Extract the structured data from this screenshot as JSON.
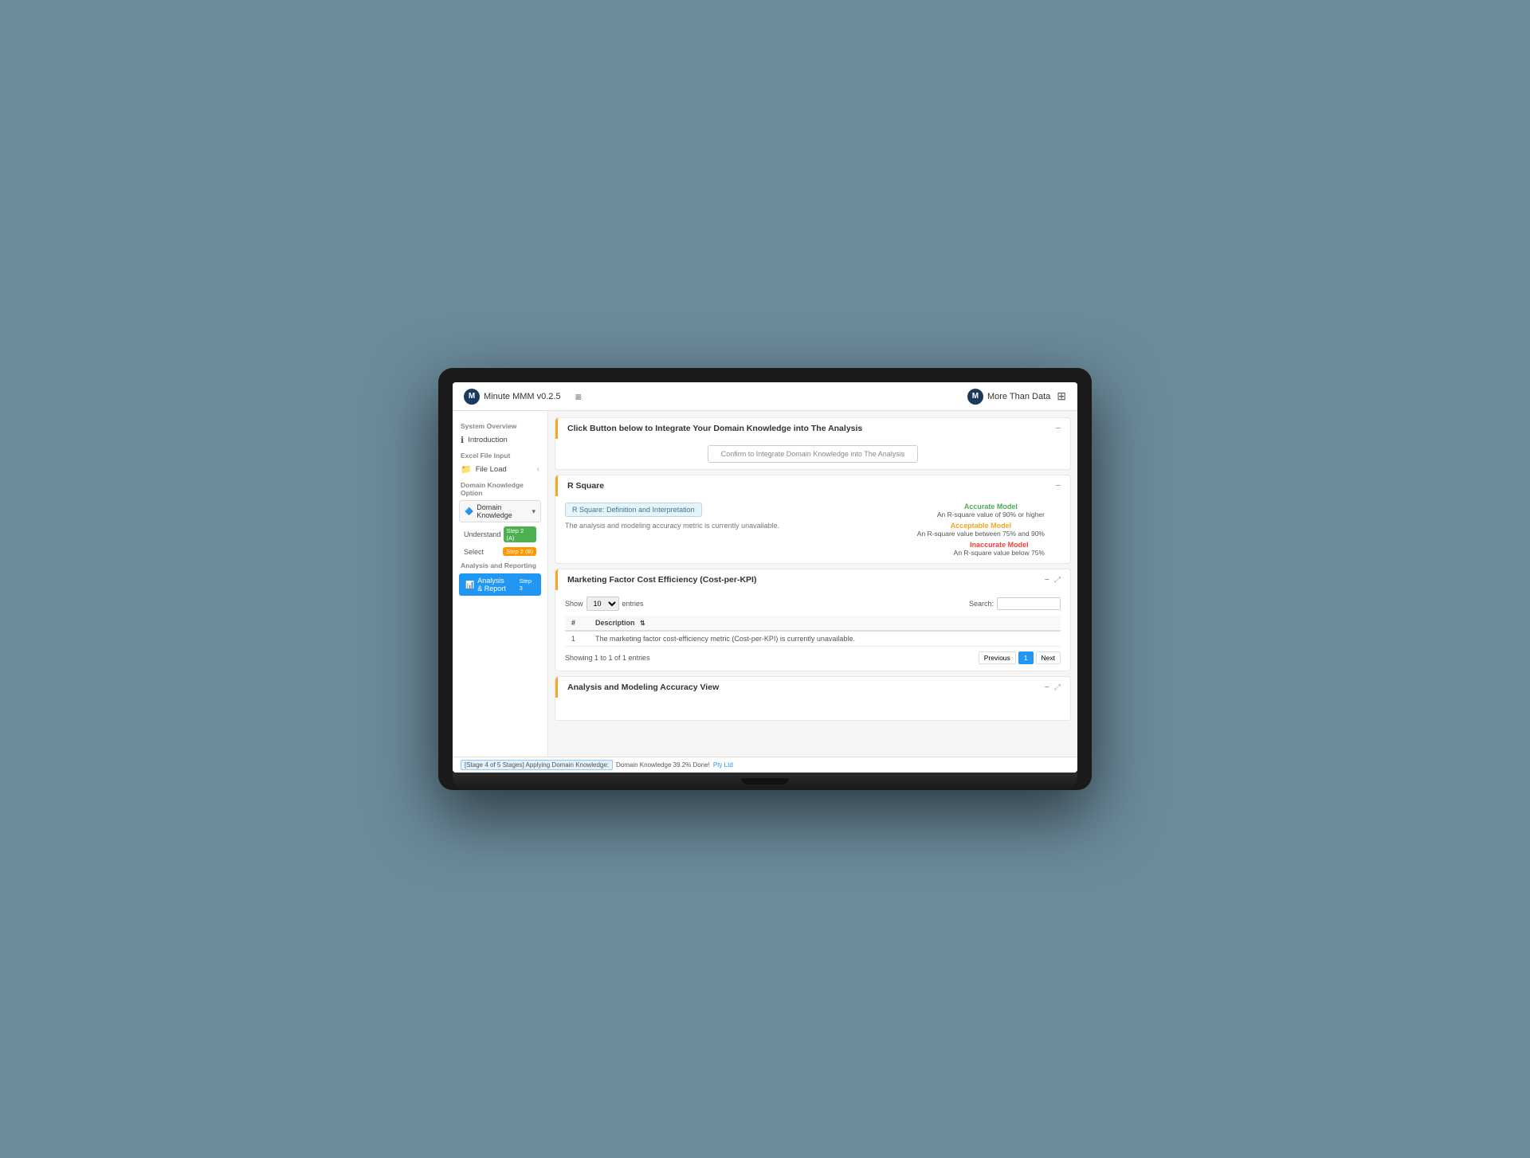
{
  "app": {
    "title": "Minute MMM v0.2.5",
    "brand": "More Than Data",
    "logo_letter": "M"
  },
  "navbar": {
    "hamburger": "≡",
    "grid_icon": "⊞"
  },
  "sidebar": {
    "system_overview_label": "System Overview",
    "introduction_label": "Introduction",
    "excel_file_input_label": "Excel File Input",
    "file_load_label": "File Load",
    "domain_knowledge_option_label": "Domain Knowledge Option",
    "domain_knowledge_dropdown": "Domain Knowledge",
    "understand_label": "Understand",
    "understand_badge": "Step 2 (A)",
    "select_label": "Select",
    "select_badge": "Step 2 (B)",
    "analysis_reporting_label": "Analysis and Reporting",
    "analysis_report_label": "Analysis & Report",
    "analysis_report_badge": "Step 3"
  },
  "domain_knowledge_card": {
    "title": "Click Button below to Integrate Your Domain Knowledge into The Analysis",
    "confirm_button": "Confirm to Integrate Domain Knowledge into The Analysis",
    "collapse_icon": "−"
  },
  "rsquare_card": {
    "title": "R Square",
    "collapse_icon": "−",
    "tag_label": "R Square: Definition and Interpretation",
    "description": "The analysis and modeling accuracy metric is currently unavailable.",
    "accurate_model_label": "Accurate Model",
    "accurate_model_desc": "An R-square value of 90% or higher",
    "acceptable_model_label": "Acceptable Model",
    "acceptable_model_desc": "An R-square value between 75% and 90%",
    "inaccurate_model_label": "Inaccurate Model",
    "inaccurate_model_desc": "An R-square value below 75%"
  },
  "marketing_table_card": {
    "title": "Marketing Factor Cost Efficiency (Cost-per-KPI)",
    "collapse_icon": "−",
    "expand_icon": "⤢",
    "show_label": "Show",
    "entries_value": "10",
    "entries_label": "entries",
    "search_label": "Search:",
    "search_value": "",
    "column_header": "Description",
    "sort_icon": "⇅",
    "row_number": "1",
    "row_description": "The marketing factor cost-efficiency metric (Cost-per-KPI) is currently unavailable.",
    "showing_label": "Showing 1 to 1 of 1 entries",
    "previous_btn": "Previous",
    "page_number": "1",
    "next_btn": "Next"
  },
  "analysis_view_card": {
    "title": "Analysis and Modeling Accuracy View",
    "collapse_icon": "−",
    "expand_icon": "⤢"
  },
  "status_bar": {
    "stage_text": "[Stage 4 of 5 Stages] Applying Domain Knowledge:",
    "domain_text": "Domain Knowledge 39.2% Done!",
    "link_text": "Pty Ltd"
  }
}
